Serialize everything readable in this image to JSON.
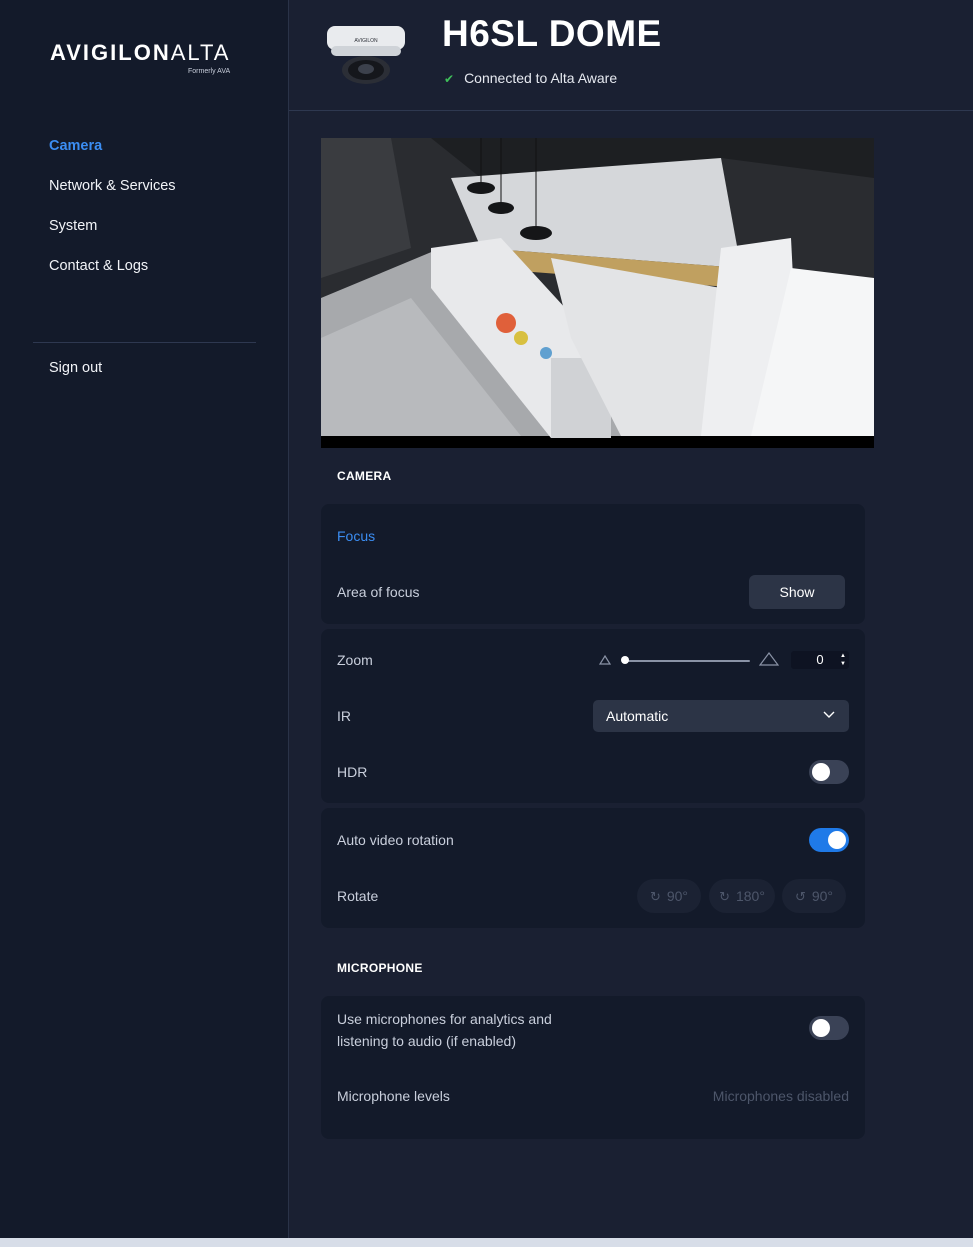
{
  "brand": {
    "name_part1": "AVIGILON",
    "name_part2": "ALTA",
    "formerly": "Formerly AVA"
  },
  "sidebar": {
    "items": [
      {
        "label": "Camera",
        "active": true
      },
      {
        "label": "Network & Services",
        "active": false
      },
      {
        "label": "System",
        "active": false
      },
      {
        "label": "Contact & Logs",
        "active": false
      }
    ],
    "sign_out": "Sign out"
  },
  "header": {
    "title": "H6SL DOME",
    "status": "Connected to Alta Aware",
    "camera_badge": "AVIGILON"
  },
  "camera_section": {
    "title": "CAMERA",
    "focus_label": "Focus",
    "area_of_focus_label": "Area of focus",
    "show_button": "Show",
    "zoom_label": "Zoom",
    "zoom_value": "0",
    "zoom_fraction": 0,
    "ir_label": "IR",
    "ir_value": "Automatic",
    "hdr_label": "HDR",
    "hdr_enabled": false,
    "auto_rotation_label": "Auto video rotation",
    "auto_rotation_enabled": true,
    "rotate_label": "Rotate",
    "rotate_buttons": [
      "90°",
      "180°",
      "90°"
    ]
  },
  "microphone_section": {
    "title": "MICROPHONE",
    "use_mic_label_line1": "Use microphones for analytics and",
    "use_mic_label_line2": "listening to audio (if enabled)",
    "use_mic_enabled": false,
    "levels_label": "Microphone levels",
    "levels_status": "Microphones disabled"
  },
  "colors": {
    "accent": "#3b8df2",
    "toggle_on": "#1f7ae8",
    "status_ok": "#3fbf5a"
  }
}
